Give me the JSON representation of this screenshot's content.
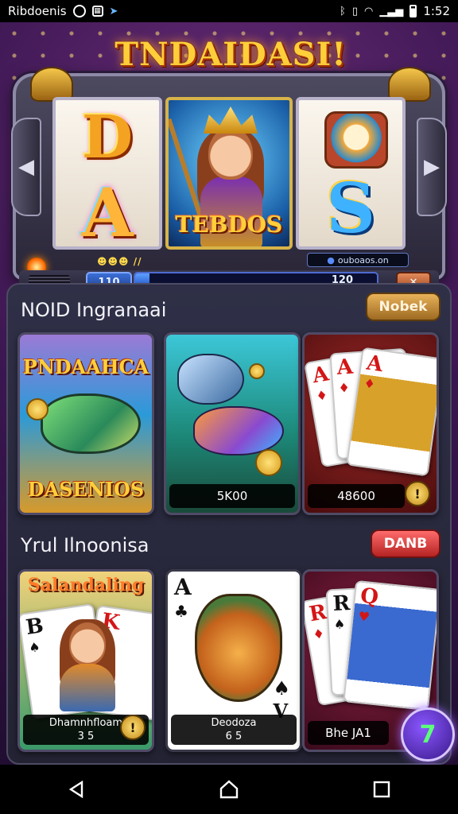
{
  "status_bar": {
    "app_name": "Ribdoenis",
    "time": "1:52",
    "icons": [
      "app-circle-icon",
      "app-square-icon",
      "signal-arrow-icon",
      "bluetooth-icon",
      "vibrate-icon",
      "wifi-icon",
      "cell-signal-icon",
      "battery-icon"
    ]
  },
  "slot": {
    "title": "TNDAIDASI!",
    "reel_center_label": "TEBDOS",
    "coins_text": "☻☻☻ //",
    "credit_text": "ouboaos.on",
    "bet_value": "110",
    "progress_value": "120",
    "progress_fraction": 0.06
  },
  "sections": [
    {
      "title": "NOID Ingranaai",
      "button_label": "Nobek",
      "games": [
        {
          "art_text": "PNDAAHCA",
          "art_text_bottom": "DASENIOS",
          "label": ""
        },
        {
          "art_text": "",
          "art_text_bottom": "",
          "label": "5K00"
        },
        {
          "art_text": "",
          "art_text_bottom": "",
          "label": "48600"
        }
      ]
    },
    {
      "title": "Yrul Ilnoonisa",
      "button_label": "DANB",
      "games": [
        {
          "art_text": "Salandaling",
          "label_line1": "Dhamnhfloam",
          "label_line2": "3 5"
        },
        {
          "art_text": "",
          "label_line1": "Deodoza",
          "label_line2": "6 5"
        },
        {
          "art_text": "",
          "label_line1": "Bhe JA1",
          "label_line2": ""
        }
      ]
    }
  ],
  "fab_glyph": "7",
  "nav": {
    "back_icon": "back-triangle-icon",
    "home_icon": "home-icon",
    "recents_icon": "recents-square-icon"
  },
  "colors": {
    "gold": "#ffcf3a",
    "panel": "#2f3047",
    "button_gold": "#c48a3a",
    "button_red": "#e03a3a"
  }
}
